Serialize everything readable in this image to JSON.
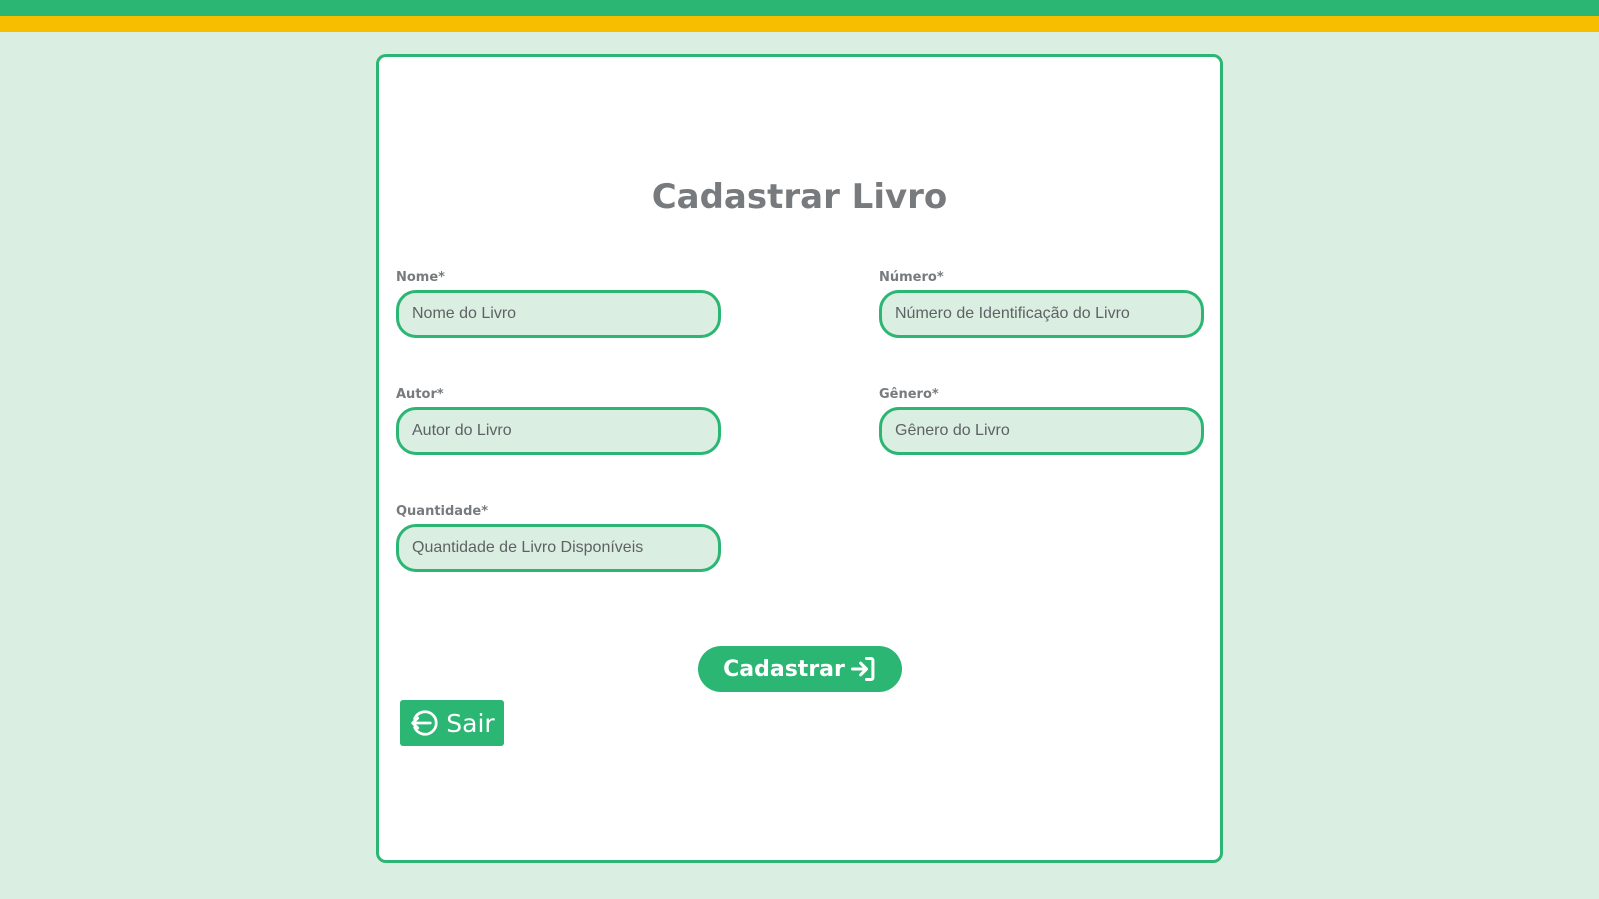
{
  "colors": {
    "background": "#dbeee2",
    "brand_green": "#2bb673",
    "brand_yellow": "#f7be00",
    "text_gray": "#777b7e"
  },
  "form": {
    "title": "Cadastrar Livro",
    "fields": {
      "nome": {
        "label": "Nome*",
        "placeholder": "Nome do Livro",
        "value": ""
      },
      "numero": {
        "label": "Número*",
        "placeholder": "Número de Identificação do Livro",
        "value": ""
      },
      "autor": {
        "label": "Autor*",
        "placeholder": "Autor do Livro",
        "value": ""
      },
      "genero": {
        "label": "Gênero*",
        "placeholder": "Gênero do Livro",
        "value": ""
      },
      "quantidade": {
        "label": "Quantidade*",
        "placeholder": "Quantidade de Livro Disponíveis",
        "value": ""
      }
    },
    "submit": {
      "label": "Cadastrar",
      "icon": "login-arrow-icon"
    },
    "exit": {
      "label": "Sair",
      "icon": "logout-arrow-icon"
    }
  }
}
